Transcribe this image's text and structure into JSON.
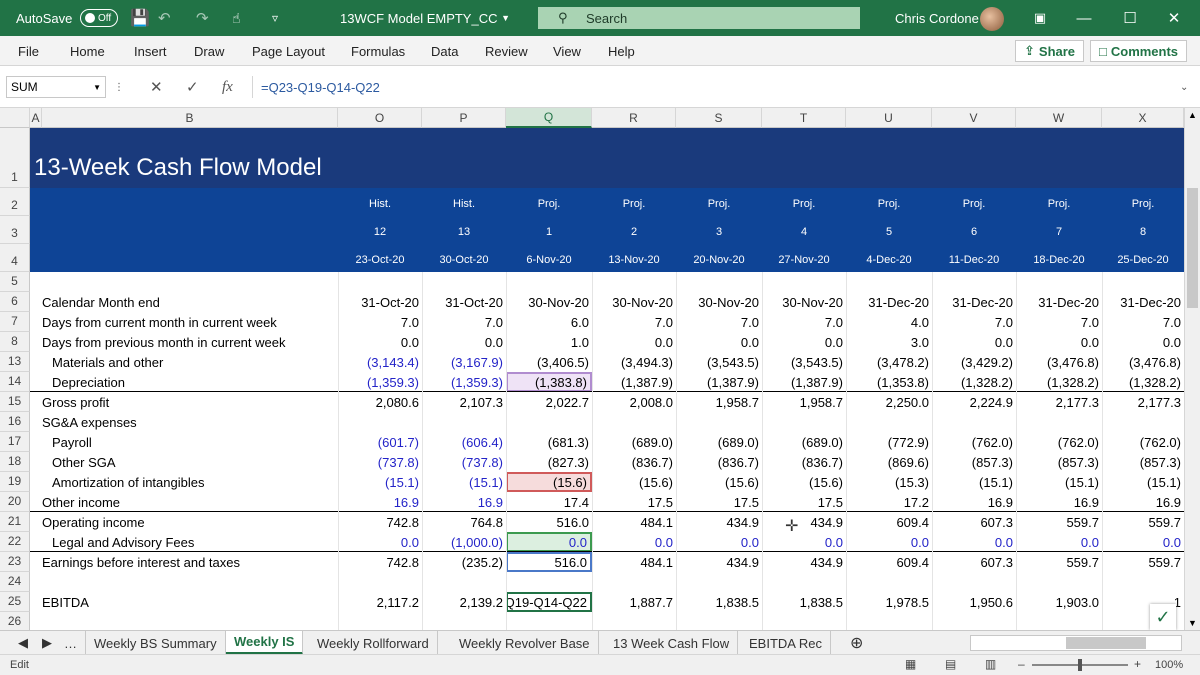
{
  "titlebar": {
    "autosave_label": "AutoSave",
    "autosave_state": "Off",
    "doc_title": "13WCF Model EMPTY_CC",
    "search_placeholder": "Search",
    "user_name": "Chris Cordone"
  },
  "menu": {
    "tabs": [
      "File",
      "Home",
      "Insert",
      "Draw",
      "Page Layout",
      "Formulas",
      "Data",
      "Review",
      "View",
      "Help"
    ],
    "share_label": "Share",
    "comments_label": "Comments"
  },
  "formula_bar": {
    "name_box": "SUM",
    "fx_label": "fx",
    "formula": "=Q23-Q19-Q14-Q22"
  },
  "columns": [
    "A",
    "B",
    "O",
    "P",
    "Q",
    "R",
    "S",
    "T",
    "U",
    "V",
    "W",
    "X"
  ],
  "title_text": "13-Week Cash Flow Model",
  "header_rows": {
    "type": [
      "Hist.",
      "Hist.",
      "Proj.",
      "Proj.",
      "Proj.",
      "Proj.",
      "Proj.",
      "Proj.",
      "Proj.",
      "Proj."
    ],
    "week": [
      "12",
      "13",
      "1",
      "2",
      "3",
      "4",
      "5",
      "6",
      "7",
      "8"
    ],
    "date": [
      "23-Oct-20",
      "30-Oct-20",
      "6-Nov-20",
      "13-Nov-20",
      "20-Nov-20",
      "27-Nov-20",
      "4-Dec-20",
      "11-Dec-20",
      "18-Dec-20",
      "25-Dec-20"
    ]
  },
  "rows": [
    {
      "num": "1"
    },
    {
      "num": "2"
    },
    {
      "num": "3"
    },
    {
      "num": "4"
    },
    {
      "num": "5"
    },
    {
      "num": "6",
      "label": "Calendar Month end",
      "indent": false,
      "values": [
        "31-Oct-20",
        "31-Oct-20",
        "30-Nov-20",
        "30-Nov-20",
        "30-Nov-20",
        "30-Nov-20",
        "31-Dec-20",
        "31-Dec-20",
        "31-Dec-20",
        "31-Dec-20"
      ],
      "blue": false
    },
    {
      "num": "7",
      "label": "Days from current month in current week",
      "indent": false,
      "values": [
        "7.0",
        "7.0",
        "6.0",
        "7.0",
        "7.0",
        "7.0",
        "4.0",
        "7.0",
        "7.0",
        "7.0"
      ],
      "blue": false
    },
    {
      "num": "8",
      "label": "Days from previous month in current week",
      "indent": false,
      "values": [
        "0.0",
        "0.0",
        "1.0",
        "0.0",
        "0.0",
        "0.0",
        "3.0",
        "0.0",
        "0.0",
        "0.0"
      ],
      "blue": false
    },
    {
      "num": "13",
      "label": "Materials and other",
      "indent": true,
      "values": [
        "(3,143.4)",
        "(3,167.9)",
        "(3,406.5)",
        "(3,494.3)",
        "(3,543.5)",
        "(3,543.5)",
        "(3,478.2)",
        "(3,429.2)",
        "(3,476.8)",
        "(3,476.8)"
      ],
      "blue": true
    },
    {
      "num": "14",
      "label": "Depreciation",
      "indent": true,
      "values": [
        "(1,359.3)",
        "(1,359.3)",
        "(1,383.8)",
        "(1,387.9)",
        "(1,387.9)",
        "(1,387.9)",
        "(1,353.8)",
        "(1,328.2)",
        "(1,328.2)",
        "(1,328.2)"
      ],
      "blue": true
    },
    {
      "num": "15",
      "label": "Gross profit",
      "indent": false,
      "values": [
        "2,080.6",
        "2,107.3",
        "2,022.7",
        "2,008.0",
        "1,958.7",
        "1,958.7",
        "2,250.0",
        "2,224.9",
        "2,177.3",
        "2,177.3"
      ],
      "blue": false
    },
    {
      "num": "16",
      "label": "SG&A expenses",
      "indent": false,
      "values": [
        "",
        "",
        "",
        "",
        "",
        "",
        "",
        "",
        "",
        ""
      ],
      "blue": false
    },
    {
      "num": "17",
      "label": "Payroll",
      "indent": true,
      "values": [
        "(601.7)",
        "(606.4)",
        "(681.3)",
        "(689.0)",
        "(689.0)",
        "(689.0)",
        "(772.9)",
        "(762.0)",
        "(762.0)",
        "(762.0)"
      ],
      "blue": true
    },
    {
      "num": "18",
      "label": "Other SGA",
      "indent": true,
      "values": [
        "(737.8)",
        "(737.8)",
        "(827.3)",
        "(836.7)",
        "(836.7)",
        "(836.7)",
        "(869.6)",
        "(857.3)",
        "(857.3)",
        "(857.3)"
      ],
      "blue": true
    },
    {
      "num": "19",
      "label": "Amortization of intangibles",
      "indent": true,
      "values": [
        "(15.1)",
        "(15.1)",
        "(15.6)",
        "(15.6)",
        "(15.6)",
        "(15.6)",
        "(15.3)",
        "(15.1)",
        "(15.1)",
        "(15.1)"
      ],
      "blue": true
    },
    {
      "num": "20",
      "label": "Other income",
      "indent": false,
      "values": [
        "16.9",
        "16.9",
        "17.4",
        "17.5",
        "17.5",
        "17.5",
        "17.2",
        "16.9",
        "16.9",
        "16.9"
      ],
      "blue": true
    },
    {
      "num": "21",
      "label": "Operating income",
      "indent": false,
      "values": [
        "742.8",
        "764.8",
        "516.0",
        "484.1",
        "434.9",
        "434.9",
        "609.4",
        "607.3",
        "559.7",
        "559.7"
      ],
      "blue": false
    },
    {
      "num": "22",
      "label": "Legal and Advisory Fees",
      "indent": true,
      "values": [
        "0.0",
        "(1,000.0)",
        "0.0",
        "0.0",
        "0.0",
        "0.0",
        "0.0",
        "0.0",
        "0.0",
        "0.0"
      ],
      "blue": true
    },
    {
      "num": "23",
      "label": "Earnings before interest and taxes",
      "indent": false,
      "values": [
        "742.8",
        "(235.2)",
        "516.0",
        "484.1",
        "434.9",
        "434.9",
        "609.4",
        "607.3",
        "559.7",
        "559.7"
      ],
      "blue": false
    },
    {
      "num": "24"
    },
    {
      "num": "25",
      "label": "EBITDA",
      "indent": false,
      "values": [
        "2,117.2",
        "2,139.2",
        "Q19-Q14-Q22",
        "1,887.7",
        "1,838.5",
        "1,838.5",
        "1,978.5",
        "1,950.6",
        "1,903.0",
        "1"
      ],
      "blue": false
    },
    {
      "num": "26"
    }
  ],
  "sheets": [
    "Weekly BS Summary",
    "Weekly IS",
    "Weekly Rollforward",
    "Weekly Revolver Base",
    "13 Week Cash Flow",
    "EBITDA Rec"
  ],
  "status": {
    "mode": "Edit",
    "zoom": "100%"
  }
}
